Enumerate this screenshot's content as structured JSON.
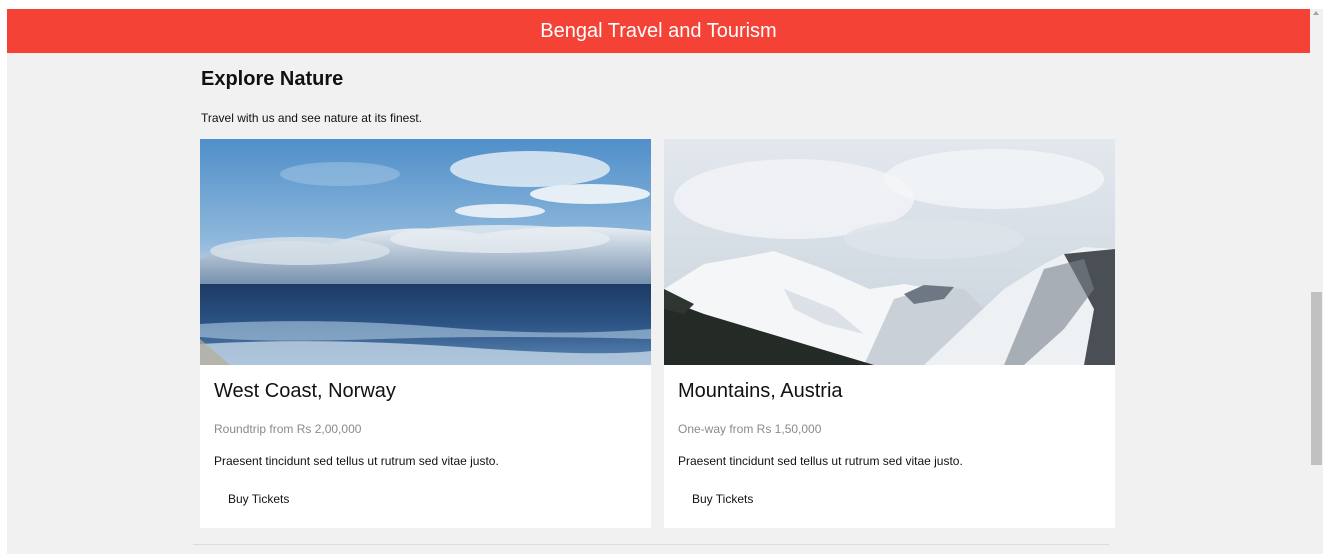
{
  "header": {
    "title": "Bengal Travel and Tourism",
    "color": "#f44336"
  },
  "section": {
    "title": "Explore Nature",
    "subtitle": "Travel with us and see nature at its finest."
  },
  "cards": [
    {
      "title": "West Coast, Norway",
      "price": "Roundtrip from Rs 2,00,000",
      "description": "Praesent tincidunt sed tellus ut rutrum sed vitae justo.",
      "button_label": "Buy Tickets"
    },
    {
      "title": "Mountains, Austria",
      "price": "One-way from Rs 1,50,000",
      "description": "Praesent tincidunt sed tellus ut rutrum sed vitae justo.",
      "button_label": "Buy Tickets"
    }
  ]
}
